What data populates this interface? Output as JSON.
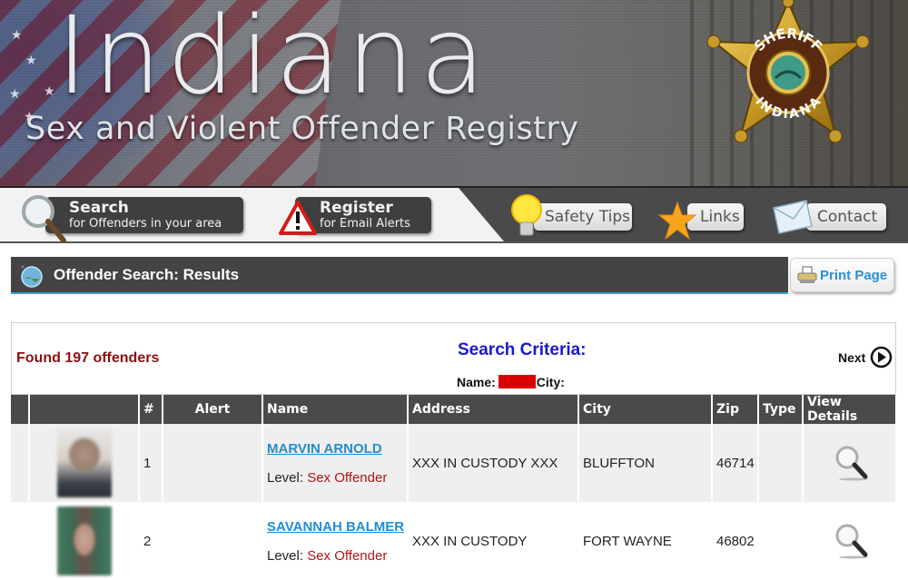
{
  "banner": {
    "title": "Indiana",
    "subtitle": "Sex and Violent Offender Registry",
    "badge_top_text": "SHERIFF",
    "badge_bottom_text": "INDIANA"
  },
  "nav": {
    "search": {
      "line1": "Search",
      "line2": "for Offenders in your area",
      "icon": "magnifier-icon"
    },
    "register": {
      "line1": "Register",
      "line2": "for Email Alerts",
      "icon": "warning-triangle-icon"
    },
    "safety_tips": {
      "label": "Safety Tips",
      "icon": "lightbulb-icon"
    },
    "links": {
      "label": "Links",
      "icon": "star-icon"
    },
    "contact": {
      "label": "Contact",
      "icon": "envelope-icon"
    }
  },
  "section": {
    "title": "Offender Search: Results",
    "icon": "globe-icon",
    "print_label": "Print Page",
    "print_icon": "printer-icon"
  },
  "results": {
    "found_text": "Found 197 offenders",
    "criteria_title": "Search Criteria:",
    "name_label": "Name:",
    "city_label": "City:",
    "next_label": "Next"
  },
  "colors": {
    "header_bg": "#4a4a4a",
    "link_blue": "#1e8ed6",
    "found_red": "#8b1010",
    "criteria_blue": "#1a1acc",
    "level_red": "#b01515",
    "redaction": "#dd0000"
  },
  "table": {
    "headers": [
      "",
      "",
      "#",
      "Alert",
      "Name",
      "Address",
      "City",
      "Zip",
      "Type",
      "View Details"
    ],
    "rows": [
      {
        "num": "1",
        "alert": "",
        "name": "MARVIN ARNOLD",
        "level_label": "Level:",
        "level": "Sex Offender",
        "address": "XXX IN CUSTODY XXX",
        "city": "BLUFFTON",
        "zip": "46714",
        "type": ""
      },
      {
        "num": "2",
        "alert": "",
        "name": "SAVANNAH BALMER",
        "level_label": "Level:",
        "level": "Sex Offender",
        "address": "XXX IN CUSTODY",
        "city": "FORT WAYNE",
        "zip": "46802",
        "type": ""
      }
    ]
  }
}
